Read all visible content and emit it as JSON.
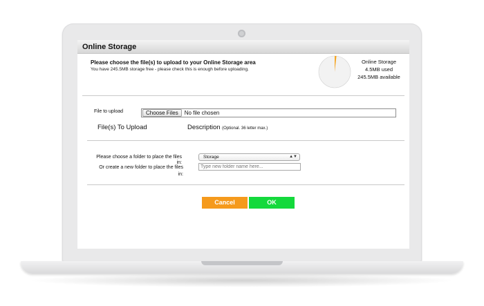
{
  "window": {
    "title": "Online Storage"
  },
  "header": {
    "title": "Please choose the file(s) to upload to your Online Storage area",
    "subtitle": "You have 245.5MB storage free - please check this is enough before uploading."
  },
  "storage": {
    "label": "Online Storage",
    "used": "4.5MB used",
    "available": "245.5MB available",
    "used_fraction": 0.018,
    "used_color": "#f5a623",
    "free_color": "#f2f2f2"
  },
  "upload": {
    "file_label": "File to upload",
    "choose_button": "Choose Files",
    "no_file": "No file chosen",
    "col_files": "File(s) To Upload",
    "col_description": "Description",
    "col_description_note": "(Optional. 36 letter max.)"
  },
  "folder": {
    "choose_label": "Please choose a folder to place the files in:",
    "selected": "Storage",
    "new_label": "Or create a new folder to place the files in:",
    "new_placeholder": "Type new folder name here..."
  },
  "actions": {
    "cancel": "Cancel",
    "ok": "OK",
    "cancel_color": "#f59a1c",
    "ok_color": "#14d93c"
  }
}
